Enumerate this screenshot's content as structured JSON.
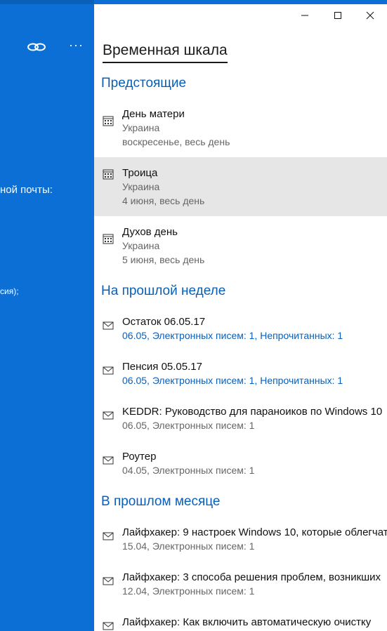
{
  "left_panel": {
    "label_mail": "ной почты:",
    "label_small": "сия);"
  },
  "timeline": {
    "title": "Временная шкала",
    "sections": {
      "upcoming": {
        "title": "Предстоящие",
        "items": [
          {
            "title": "День матери",
            "location": "Украина",
            "when": "воскресенье, весь день"
          },
          {
            "title": "Троица",
            "location": "Украина",
            "when": "4 июня, весь день"
          },
          {
            "title": "Духов день",
            "location": "Украина",
            "when": "5 июня, весь день"
          }
        ]
      },
      "last_week": {
        "title": "На прошлой неделе",
        "items": [
          {
            "title": "Остаток 06.05.17",
            "meta": "06.05, Электронных писем: 1, Непрочитанных: 1",
            "unread": true
          },
          {
            "title": "Пенсия 05.05.17",
            "meta": "06.05, Электронных писем: 1, Непрочитанных: 1",
            "unread": true
          },
          {
            "title": "KEDDR: Руководство для параноиков по Windows 10",
            "meta": "06.05, Электронных писем: 1",
            "unread": false
          },
          {
            "title": "Роутер",
            "meta": "04.05, Электронных писем: 1",
            "unread": false
          }
        ]
      },
      "last_month": {
        "title": "В прошлом месяце",
        "items": [
          {
            "title": "Лайфхакер: 9 настроек Windows 10, которые облегчат",
            "meta": "15.04, Электронных писем: 1",
            "unread": false
          },
          {
            "title": "Лайфхакер: 3 способа решения проблем, возникших",
            "meta": "12.04, Электронных писем: 1",
            "unread": false
          },
          {
            "title": "Лайфхакер: Как включить автоматическую очистку",
            "meta": "",
            "unread": false
          }
        ]
      }
    }
  },
  "colors": {
    "accent_blue": "#0b6fd6",
    "section_blue": "#0a5fb8",
    "selected_bg": "#e6e6e6"
  },
  "icons": {
    "link": "link-icon",
    "more": "more-icon",
    "calendar": "calendar-icon",
    "mail": "mail-icon",
    "minimize": "minimize-icon",
    "maximize": "maximize-icon",
    "close": "close-icon"
  }
}
